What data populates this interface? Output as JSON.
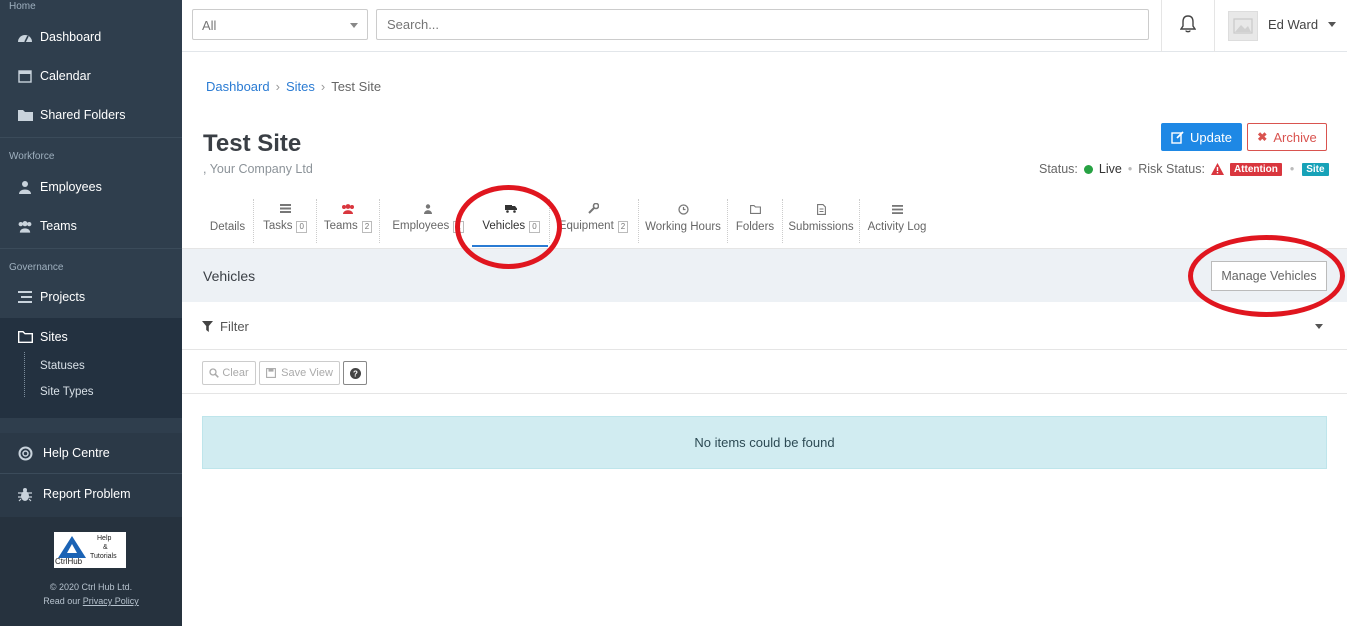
{
  "sidebar": {
    "sections": {
      "home": "Home",
      "workforce": "Workforce",
      "governance": "Governance"
    },
    "items": [
      {
        "label": "Dashboard",
        "icon": "dashboard-icon"
      },
      {
        "label": "Calendar",
        "icon": "calendar-icon"
      },
      {
        "label": "Shared Folders",
        "icon": "folder-icon"
      },
      {
        "label": "Employees",
        "icon": "user-icon"
      },
      {
        "label": "Teams",
        "icon": "users-icon"
      },
      {
        "label": "Projects",
        "icon": "list-icon"
      },
      {
        "label": "Sites",
        "icon": "folder-open-icon"
      }
    ],
    "sub_items": [
      "Statuses",
      "Site Types"
    ],
    "bottom": [
      {
        "label": "Help Centre",
        "icon": "lifebuoy-icon"
      },
      {
        "label": "Report Problem",
        "icon": "bug-icon"
      }
    ],
    "logo": {
      "brand": "CtrlHub",
      "text1": "Help",
      "text2": "&",
      "text3": "Tutorials"
    },
    "footer": {
      "copyright": "© 2020 Ctrl Hub Ltd.",
      "read_prefix": "Read our",
      "privacy": "Privacy Policy"
    }
  },
  "topbar": {
    "filter_value": "All",
    "search_placeholder": "Search...",
    "user_name": "Ed Ward"
  },
  "breadcrumb": [
    "Dashboard",
    "Sites",
    "Test Site"
  ],
  "page": {
    "title": "Test Site",
    "subtitle": ", Your Company Ltd",
    "update_label": "Update",
    "archive_label": "Archive",
    "status_label": "Status:",
    "status_value": "Live",
    "risk_label": "Risk Status:",
    "risk_badge": "Attention",
    "type_badge": "Site"
  },
  "tabs": [
    {
      "label": "Details",
      "count": null,
      "icon": ""
    },
    {
      "label": "Tasks",
      "count": "0",
      "icon": "tasks-icon"
    },
    {
      "label": "Teams",
      "count": "2",
      "icon": "teams-icon"
    },
    {
      "label": "Employees",
      "count": "1",
      "icon": "user-icon"
    },
    {
      "label": "Vehicles",
      "count": "0",
      "icon": "truck-icon",
      "active": true
    },
    {
      "label": "Equipment",
      "count": "2",
      "icon": "wrench-icon"
    },
    {
      "label": "Working Hours",
      "count": null,
      "icon": "clock-icon"
    },
    {
      "label": "Folders",
      "count": null,
      "icon": "folder-icon"
    },
    {
      "label": "Submissions",
      "count": null,
      "icon": "file-icon"
    },
    {
      "label": "Activity Log",
      "count": null,
      "icon": "list-icon"
    }
  ],
  "section": {
    "title": "Vehicles",
    "manage_label": "Manage Vehicles",
    "filter_label": "Filter",
    "clear_label": "Clear",
    "save_view_label": "Save View",
    "empty_message": "No items could be found"
  },
  "colors": {
    "sidebar": "#2f3e4d",
    "primary": "#1e88e5",
    "danger": "#d9534f",
    "annotation": "#e0161f"
  }
}
